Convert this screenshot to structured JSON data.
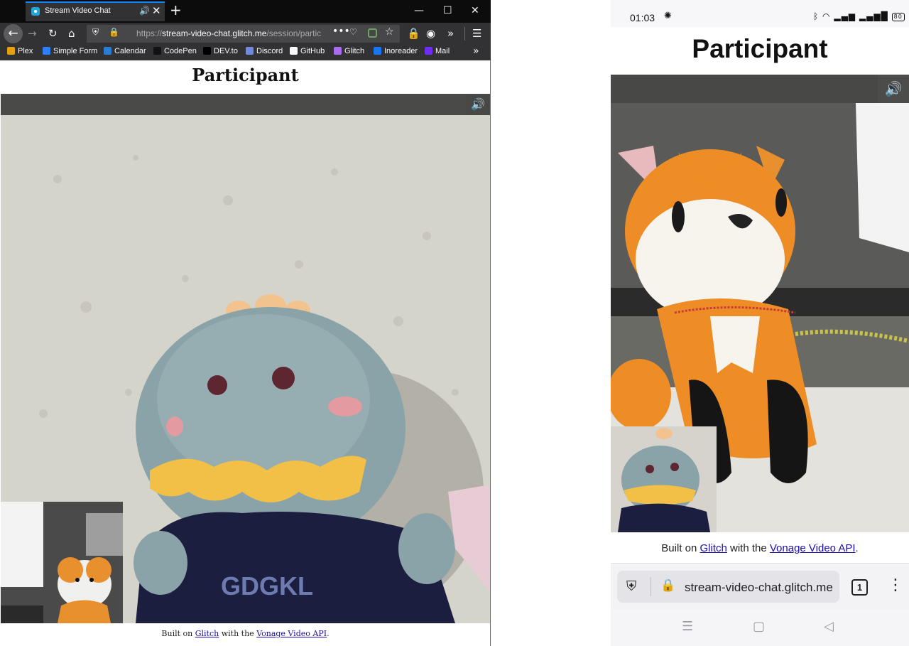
{
  "desktop": {
    "tab": {
      "title": "Stream Video Chat"
    },
    "url": {
      "prefix": "https://",
      "host": "stream-video-chat.glitch.me",
      "path": "/session/partic"
    },
    "bookmarks": [
      {
        "label": "Plex",
        "color": "#e5a00d"
      },
      {
        "label": "Simple Form",
        "color": "#2d7ff9"
      },
      {
        "label": "Calendar",
        "color": "#2b7cd3"
      },
      {
        "label": "CodePen",
        "color": "#111111"
      },
      {
        "label": "DEV.to",
        "color": "#000000"
      },
      {
        "label": "Discord",
        "color": "#7289da"
      },
      {
        "label": "GitHub",
        "color": "#f9f9fa"
      },
      {
        "label": "Glitch",
        "color": "#a96cf1"
      },
      {
        "label": "Inoreader",
        "color": "#1875f0"
      },
      {
        "label": "Mail",
        "color": "#6d2df5"
      }
    ],
    "page": {
      "title": "Participant",
      "footer": {
        "before": "Built on ",
        "link1": "Glitch",
        "middle": " with the ",
        "link2": "Vonage Video API",
        "after": "."
      }
    }
  },
  "mobile": {
    "status": {
      "time": "01:03",
      "battery": "80"
    },
    "page": {
      "title": "Participant",
      "footer": {
        "before": "Built on ",
        "link1": "Glitch",
        "middle": " with the ",
        "link2": "Vonage Video API",
        "after": "."
      }
    },
    "url": "stream-video-chat.glitch.me",
    "tab_count": "1"
  },
  "colors": {
    "accent": "#0a84ff",
    "link": "#1a0dab",
    "toolbar": "#323234"
  }
}
